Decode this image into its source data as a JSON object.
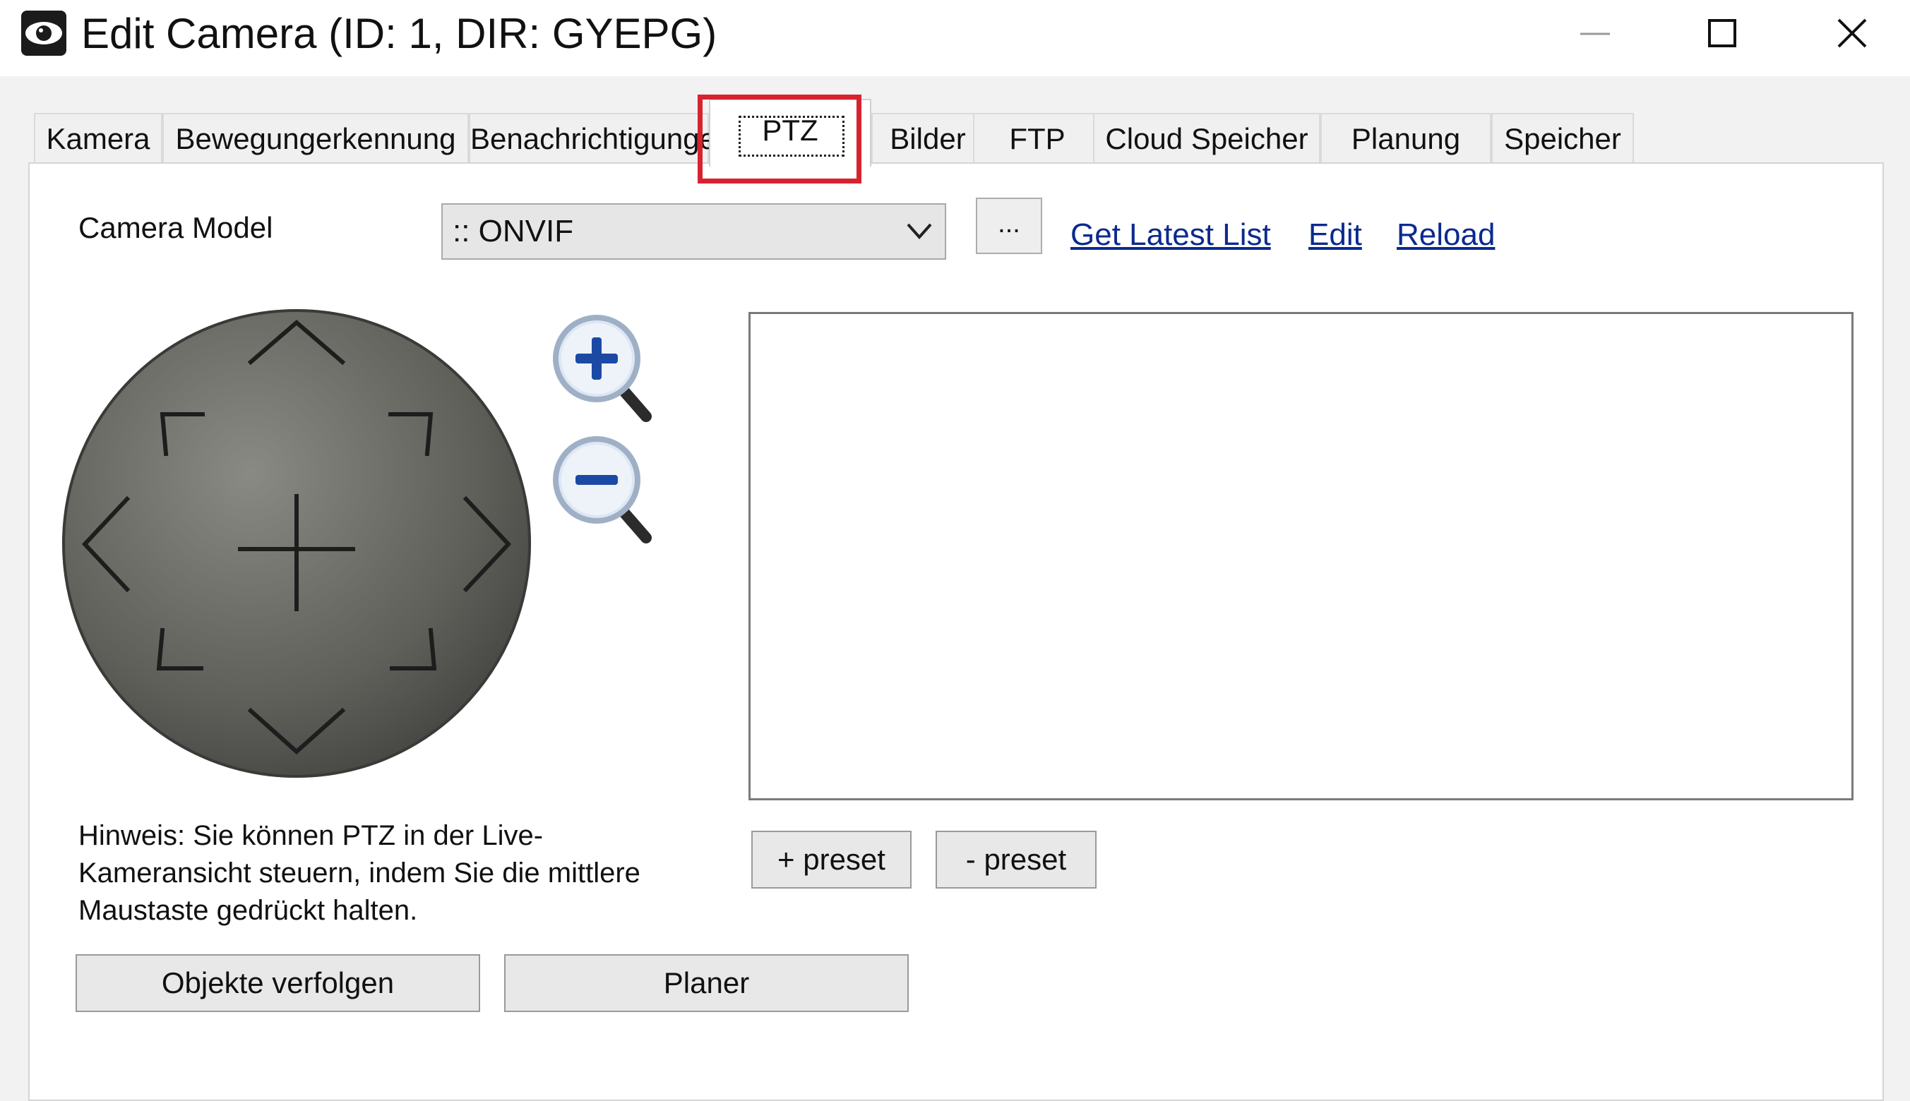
{
  "window": {
    "title": "Edit Camera (ID: 1, DIR: GYEPG)",
    "app_icon": "eye-icon",
    "controls": {
      "minimize": "minimize-icon",
      "maximize": "maximize-icon",
      "close": "close-icon"
    }
  },
  "tabs": [
    {
      "label": "Kamera",
      "active": false
    },
    {
      "label": "Bewegungerkennung",
      "active": false
    },
    {
      "label": "Benachrichtigungen",
      "active": false
    },
    {
      "label": "PTZ",
      "active": true
    },
    {
      "label": "Bilder",
      "active": false
    },
    {
      "label": "FTP",
      "active": false
    },
    {
      "label": "Cloud Speicher",
      "active": false
    },
    {
      "label": "Planung",
      "active": false
    },
    {
      "label": "Speicher",
      "active": false
    }
  ],
  "highlight_color": "#d6232f",
  "ptz": {
    "camera_model_label": "Camera Model",
    "camera_model_value": ":: ONVIF",
    "browse_button": "...",
    "links": {
      "latest": "Get Latest List",
      "edit": "Edit",
      "reload": "Reload"
    },
    "hint": "Hinweis: Sie können PTZ in der Live-Kameransicht steuern, indem Sie die mittlere Maustaste gedrückt halten.",
    "preset_add": "+ preset",
    "preset_remove": "- preset",
    "track_button": "Objekte verfolgen",
    "planner_button": "Planer",
    "zoom_in_icon": "zoom-in-icon",
    "zoom_out_icon": "zoom-out-icon",
    "link_color": "#0b2a8f"
  }
}
